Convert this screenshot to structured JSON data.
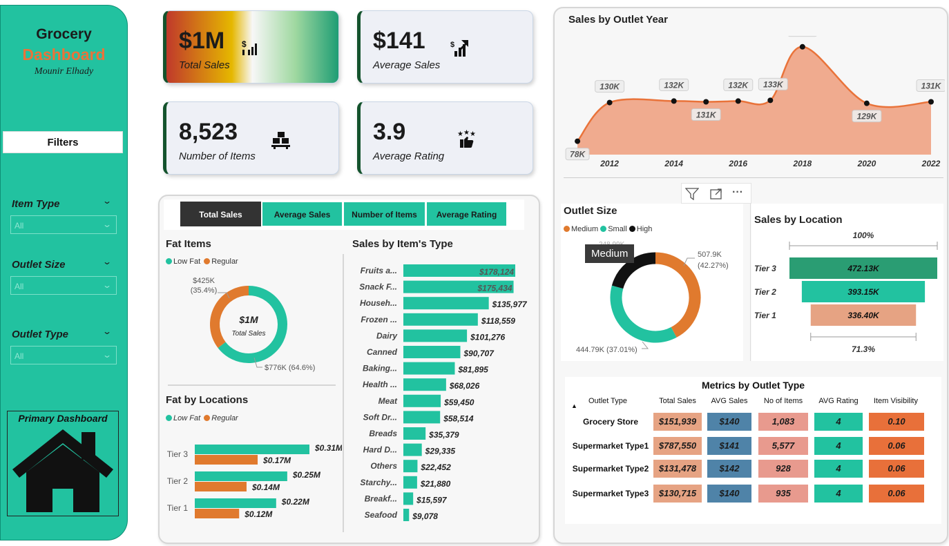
{
  "sidebar": {
    "title_line1": "Grocery",
    "title_line2": "Dashboard",
    "author": "Mounir Elhady",
    "filters_label": "Filters",
    "filters": [
      {
        "label": "Item Type",
        "value": "All"
      },
      {
        "label": "Outlet Size",
        "value": "All"
      },
      {
        "label": "Outlet Type",
        "value": "All"
      }
    ],
    "nav_label": "Primary Dashboard"
  },
  "kpis": [
    {
      "value": "$1M",
      "label": "Total Sales"
    },
    {
      "value": "$141",
      "label": "Average Sales"
    },
    {
      "value": "8,523",
      "label": "Number of Items"
    },
    {
      "value": "3.9",
      "label": "Average Rating"
    }
  ],
  "tabs": [
    "Total Sales",
    "Average Sales",
    "Number of Items",
    "Average Rating"
  ],
  "visual_toolbar": {
    "more": "···"
  },
  "tooltip": "Medium",
  "colors": {
    "teal": "#22c2a0",
    "orange": "#e07a2e",
    "black": "#111111",
    "area": "#f0ab8f",
    "line": "#e9733a"
  },
  "chart_data": [
    {
      "id": "fat_items",
      "type": "pie",
      "title": "Fat Items",
      "legend": [
        "Low Fat",
        "Regular"
      ],
      "series": [
        {
          "name": "Low Fat",
          "value": 776,
          "label": "$776K (64.6%)"
        },
        {
          "name": "Regular",
          "value": 425,
          "label": "$425K\n(35.4%)"
        }
      ],
      "center_value": "$1M",
      "center_label": "Total Sales"
    },
    {
      "id": "fat_by_locations",
      "type": "bar",
      "title": "Fat by Locations",
      "legend": [
        "Low Fat",
        "Regular"
      ],
      "categories": [
        "Tier 3",
        "Tier 2",
        "Tier 1"
      ],
      "series": [
        {
          "name": "Low Fat",
          "values": [
            0.31,
            0.25,
            0.22
          ],
          "labels": [
            "$0.31M",
            "$0.25M",
            "$0.22M"
          ]
        },
        {
          "name": "Regular",
          "values": [
            0.17,
            0.14,
            0.12
          ],
          "labels": [
            "$0.17M",
            "$0.14M",
            "$0.12M"
          ]
        }
      ]
    },
    {
      "id": "sales_by_item_type",
      "type": "bar",
      "title": "Sales by Item's Type",
      "categories": [
        "Fruits a...",
        "Snack F...",
        "Househ...",
        "Frozen ...",
        "Dairy",
        "Canned",
        "Baking...",
        "Health ...",
        "Meat",
        "Soft Dr...",
        "Breads",
        "Hard D...",
        "Others",
        "Starchy...",
        "Breakf...",
        "Seafood"
      ],
      "values": [
        178124,
        175434,
        135977,
        118559,
        101276,
        90707,
        81895,
        68026,
        59450,
        58514,
        35379,
        29335,
        22452,
        21880,
        15597,
        9078
      ],
      "labels": [
        "$178,124",
        "$175,434",
        "$135,977",
        "$118,559",
        "$101,276",
        "$90,707",
        "$81,895",
        "$68,026",
        "$59,450",
        "$58,514",
        "$35,379",
        "$29,335",
        "$22,452",
        "$21,880",
        "$15,597",
        "$9,078"
      ]
    },
    {
      "id": "sales_by_outlet_year",
      "type": "area",
      "title": "Sales by Outlet Year",
      "x": [
        2011,
        2012,
        2014,
        2015,
        2016,
        2017,
        2018,
        2020,
        2022
      ],
      "y": [
        78,
        130,
        132,
        131,
        132,
        133,
        205,
        129,
        131
      ],
      "labels": [
        "78K",
        "130K",
        "132K",
        "131K",
        "132K",
        "133K",
        "205K",
        "129K",
        "131K"
      ],
      "xticks": [
        "2012",
        "2014",
        "2016",
        "2018",
        "2020",
        "2022"
      ]
    },
    {
      "id": "outlet_size",
      "type": "pie",
      "title": "Outlet Size",
      "legend": [
        "Medium",
        "Small",
        "High"
      ],
      "series": [
        {
          "name": "Medium",
          "value": 507.9,
          "label": "507.9K\n(42.27%)"
        },
        {
          "name": "Small",
          "value": 444.79,
          "label": "444.79K (37.01%)"
        },
        {
          "name": "High",
          "value": 248.99,
          "label": "248.99K"
        }
      ]
    },
    {
      "id": "sales_by_location",
      "type": "bar",
      "title": "Sales by Location",
      "categories": [
        "Tier 3",
        "Tier 2",
        "Tier 1"
      ],
      "values": [
        472.13,
        393.15,
        336.4
      ],
      "labels": [
        "472.13K",
        "393.15K",
        "336.40K"
      ],
      "top_label": "100%",
      "bottom_label": "71.3%"
    },
    {
      "id": "metrics_by_outlet_type",
      "type": "table",
      "title": "Metrics by Outlet Type",
      "columns": [
        "Outlet Type",
        "Total Sales",
        "AVG Sales",
        "No of Items",
        "AVG Rating",
        "Item Visibility"
      ],
      "rows": [
        [
          "Grocery Store",
          "$151,939",
          "$140",
          "1,083",
          "4",
          "0.10"
        ],
        [
          "Supermarket Type1",
          "$787,550",
          "$141",
          "5,577",
          "4",
          "0.06"
        ],
        [
          "Supermarket Type2",
          "$131,478",
          "$142",
          "928",
          "4",
          "0.06"
        ],
        [
          "Supermarket Type3",
          "$130,715",
          "$140",
          "935",
          "4",
          "0.06"
        ]
      ]
    }
  ]
}
